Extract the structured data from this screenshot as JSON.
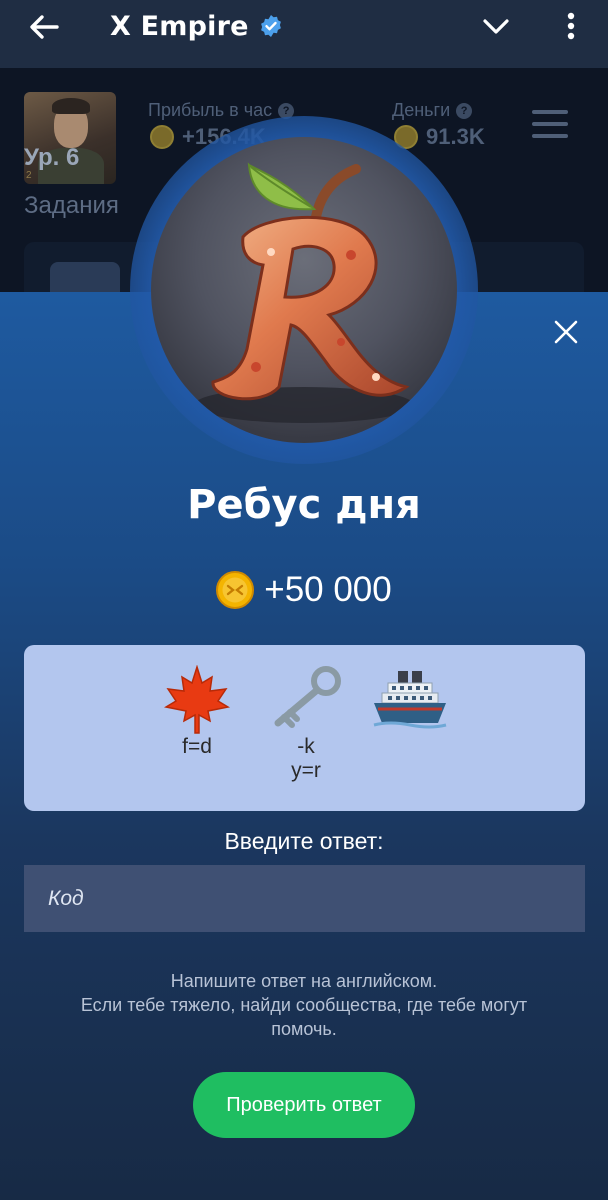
{
  "telegram_bar": {
    "title": "X Empire",
    "icons": [
      "back-arrow-icon",
      "verified-badge-icon",
      "chevron-down-icon",
      "more-vertical-icon"
    ]
  },
  "background_app": {
    "level_label": "Ур. 6",
    "level_sub": "2",
    "profit_label": "Прибыль в час",
    "profit_value": "+156.4K",
    "money_label": "Деньги",
    "money_value": "91.3K",
    "tasks_title": "Задания"
  },
  "modal": {
    "title": "Ребус дня",
    "reward": "+50 000",
    "puzzle": [
      {
        "icon": "maple-leaf-icon",
        "caption_lines": [
          "f=d"
        ]
      },
      {
        "icon": "old-key-icon",
        "caption_lines": [
          "-k",
          "y=r"
        ]
      },
      {
        "icon": "cruise-ship-icon",
        "caption_lines": []
      }
    ],
    "answer_label": "Введите ответ:",
    "answer_placeholder": "Код",
    "answer_value": "",
    "hint_lines": [
      "Напишите ответ на английском.",
      "Если тебе тяжело, найди сообщества, где тебе могут",
      "помочь."
    ],
    "submit_label": "Проверить ответ"
  },
  "colors": {
    "accent_green": "#1fbe61",
    "sheet_top": "#1e5aa0",
    "sheet_bottom": "#172a45",
    "puzzle_bg": "#b3c6ee",
    "verified_blue": "#4ca0ec"
  }
}
